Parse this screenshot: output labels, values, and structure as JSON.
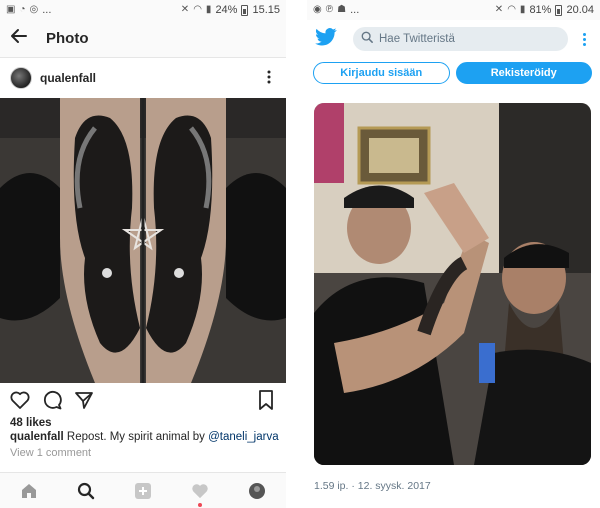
{
  "left": {
    "status": {
      "time": "15.15",
      "battery": "24%",
      "notif_dots": "..."
    },
    "header": {
      "title": "Photo"
    },
    "post": {
      "username": "qualenfall",
      "photo_alt": "goat tattoo forearms",
      "likes": "48 likes",
      "caption_user": "qualenfall",
      "caption_text": " Repost. My spirit animal by ",
      "caption_mention": "@taneli_jarva",
      "view_comments": "View 1 comment"
    },
    "nav": {
      "items": [
        "home-icon",
        "search-icon",
        "add-icon",
        "heart-icon",
        "profile-avatar"
      ]
    }
  },
  "right": {
    "status": {
      "time": "20.04",
      "battery": "81%",
      "notif_dots": "..."
    },
    "search": {
      "placeholder": "Hae Twitteristä"
    },
    "auth": {
      "login_label": "Kirjaudu sisään",
      "signup_label": "Rekisteröidy"
    },
    "tweet": {
      "timestamp": "1.59 ip. · 12. syysk. 2017"
    }
  },
  "colors": {
    "twitter_blue": "#1da1f2",
    "instagram_text": "#262626",
    "mention": "#003569",
    "notification": "#ed4956"
  }
}
